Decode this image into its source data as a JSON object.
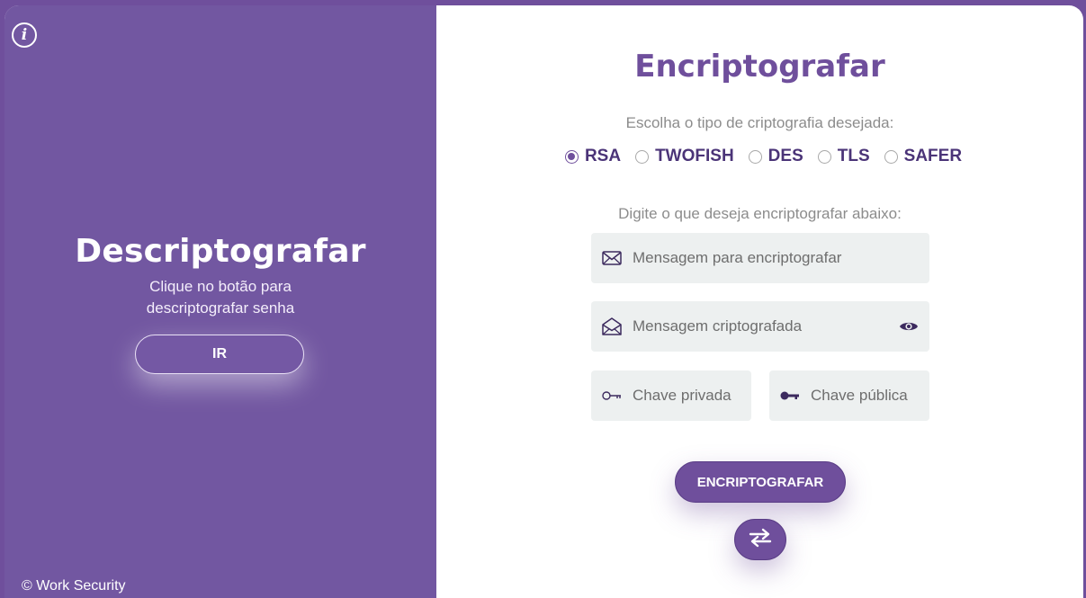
{
  "colors": {
    "accent": "#6f4f9c",
    "panel": "#7257a1",
    "field_bg": "#edf0f0",
    "radio_text": "#4b3478"
  },
  "left": {
    "info_icon": "info-circle-icon",
    "title": "Descriptografar",
    "subtitle": "Clique no botão para descriptografar senha",
    "button_label": "IR",
    "copyright": "© Work Security"
  },
  "main": {
    "title": "Encriptografar",
    "choose_label": "Escolha o tipo de criptografia desejada:",
    "algorithms": [
      {
        "label": "RSA",
        "selected": true
      },
      {
        "label": "TWOFISH",
        "selected": false
      },
      {
        "label": "DES",
        "selected": false
      },
      {
        "label": "TLS",
        "selected": false
      },
      {
        "label": "SAFER",
        "selected": false
      }
    ],
    "type_label": "Digite o que deseja encriptografar abaixo:",
    "message_field": {
      "placeholder": "Mensagem para encriptografar",
      "icon": "envelope-icon"
    },
    "encrypted_field": {
      "placeholder": "Mensagem criptografada",
      "icon": "envelope-open-icon",
      "toggle_icon": "eye-icon"
    },
    "private_key_field": {
      "placeholder": "Chave privada",
      "icon": "key-outline-icon"
    },
    "public_key_field": {
      "placeholder": "Chave pública",
      "icon": "key-solid-icon"
    },
    "submit_label": "ENCRIPTOGRAFAR",
    "swap_icon": "swap-arrows-icon"
  }
}
